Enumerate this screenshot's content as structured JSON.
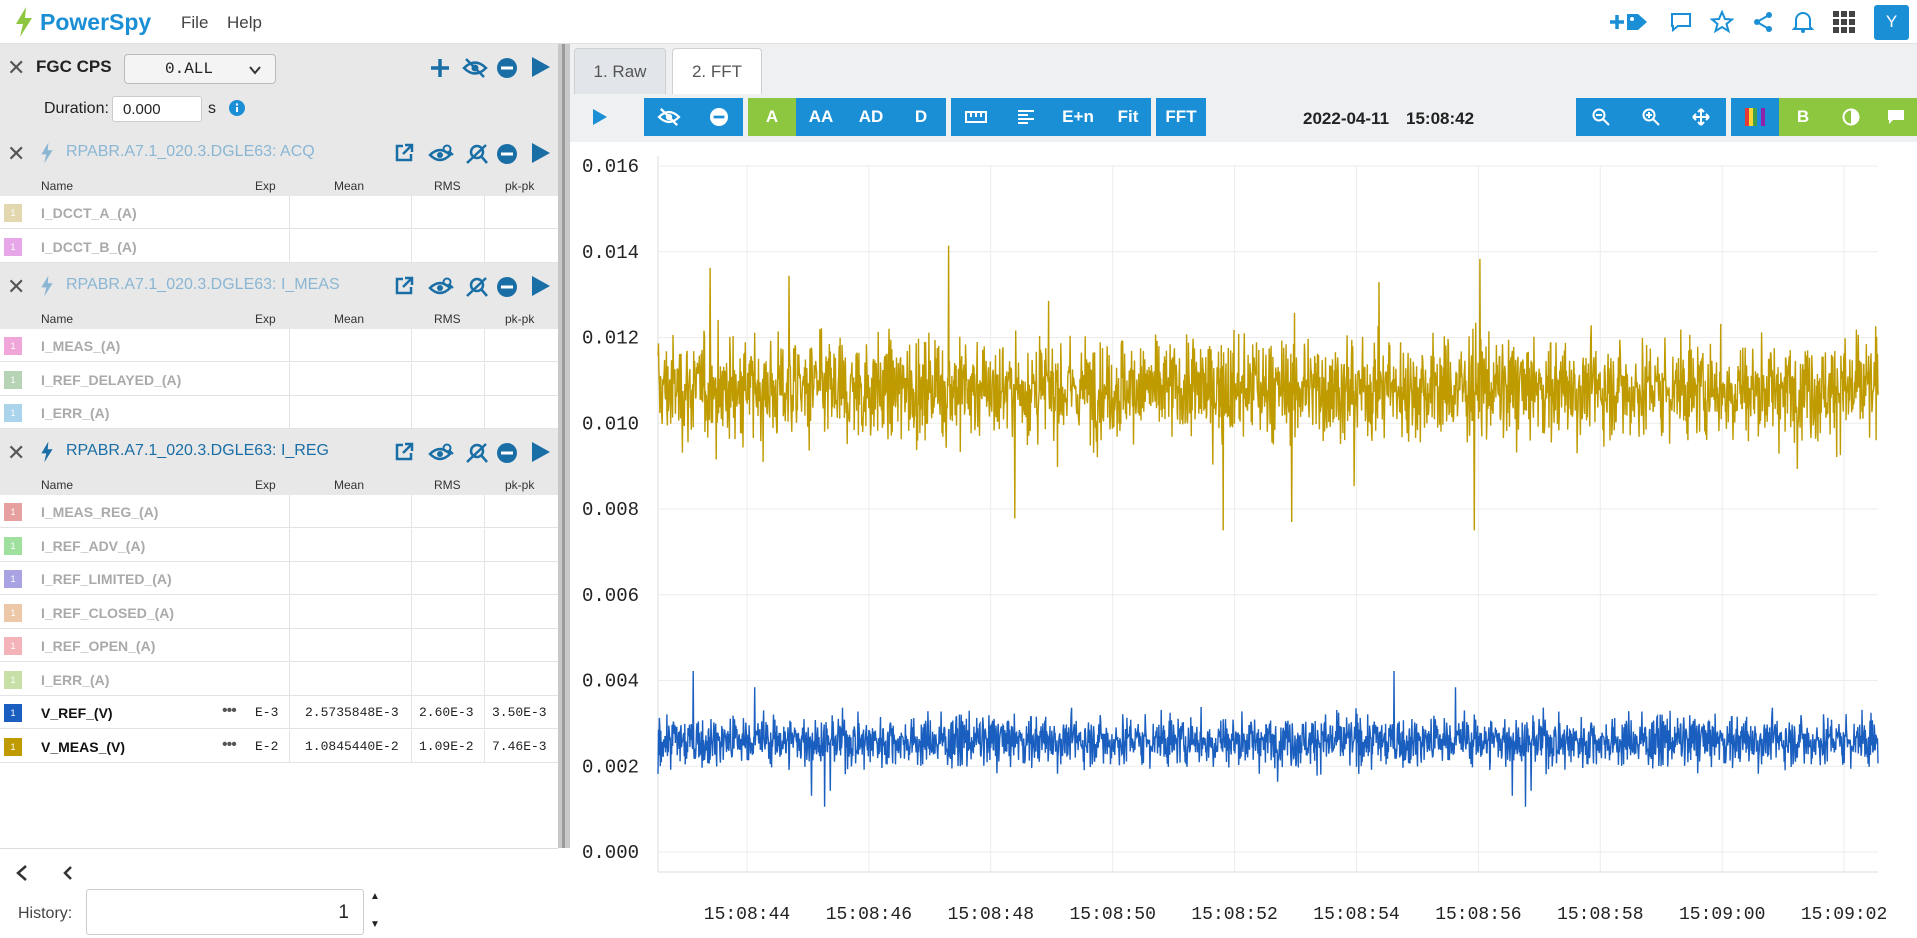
{
  "app": {
    "name": "PowerSpy",
    "menu": [
      "File",
      "Help"
    ],
    "user_initial": "Y",
    "accent": "#1a8fd6",
    "green": "#8dc63f"
  },
  "top_icons": [
    "add-tag-icon",
    "comment-icon",
    "star-icon",
    "share-icon",
    "bell-icon",
    "grid-icon"
  ],
  "device": {
    "name": "FGC CPS",
    "selector": "0.ALL",
    "duration_label": "Duration:",
    "duration_value": "0.000",
    "duration_unit": "s"
  },
  "columns": {
    "name": "Name",
    "exp": "Exp",
    "mean": "Mean",
    "rms": "RMS",
    "pkpk": "pk-pk"
  },
  "groups": [
    {
      "title": "RPABR.A7.1_020.3.DGLE63: ACQ",
      "active": false,
      "signals": [
        {
          "swatch": "#e3d7b0",
          "name": "I_DCCT_A_(A)"
        },
        {
          "swatch": "#e7a6e7",
          "name": "I_DCCT_B_(A)"
        }
      ]
    },
    {
      "title": "RPABR.A7.1_020.3.DGLE63: I_MEAS",
      "active": false,
      "signals": [
        {
          "swatch": "#f0a6d8",
          "name": "I_MEAS_(A)"
        },
        {
          "swatch": "#b7d3b5",
          "name": "I_REF_DELAYED_(A)"
        },
        {
          "swatch": "#a9d4ec",
          "name": "I_ERR_(A)"
        }
      ]
    },
    {
      "title": "RPABR.A7.1_020.3.DGLE63: I_REG",
      "active": true,
      "signals": [
        {
          "swatch": "#e7a0a0",
          "name": "I_MEAS_REG_(A)"
        },
        {
          "swatch": "#9fe09f",
          "name": "I_REF_ADV_(A)"
        },
        {
          "swatch": "#a9a3e3",
          "name": "I_REF_LIMITED_(A)"
        },
        {
          "swatch": "#ecc8a8",
          "name": "I_REF_CLOSED_(A)"
        },
        {
          "swatch": "#f3b3b9",
          "name": "I_REF_OPEN_(A)"
        },
        {
          "swatch": "#c8dfa8",
          "name": "I_ERR_(A)"
        },
        {
          "swatch": "#1a5fbf",
          "name": "V_REF_(V)",
          "active": true,
          "exp": "E-3",
          "mean": "2.5735848E-3",
          "rms": "2.60E-3",
          "pkpk": "3.50E-3"
        },
        {
          "swatch": "#bf9b00",
          "name": "V_MEAS_(V)",
          "active": true,
          "exp": "E-2",
          "mean": "1.0845440E-2",
          "rms": "1.09E-2",
          "pkpk": "7.46E-3"
        }
      ]
    }
  ],
  "swatch_label": "1",
  "history": {
    "label": "History:",
    "value": "1"
  },
  "tabs": [
    "1. Raw",
    "2. FFT"
  ],
  "toolbar": {
    "modes": [
      "A",
      "AA",
      "AD",
      "D"
    ],
    "tools": [
      "E+n",
      "Fit"
    ],
    "fft": "FFT",
    "date": "2022-04-11",
    "time": "15:08:42",
    "b": "B"
  },
  "chart_data": {
    "type": "line",
    "ylim": [
      0.0,
      0.016
    ],
    "yticks": [
      "0.016",
      "0.014",
      "0.012",
      "0.010",
      "0.008",
      "0.006",
      "0.004",
      "0.002",
      "0.000"
    ],
    "xticks": [
      "15:08:44",
      "15:08:46",
      "15:08:48",
      "15:08:50",
      "15:08:52",
      "15:08:54",
      "15:08:56",
      "15:08:58",
      "15:09:00",
      "15:09:02"
    ],
    "xlim": [
      "15:08:42.6",
      "15:09:02.6"
    ],
    "grid": true,
    "series": [
      {
        "signal": "V_MEAS_(V)",
        "color": "#bf9b00",
        "mean": 0.0108,
        "min": 0.0075,
        "max": 0.015
      },
      {
        "signal": "V_REF_(V)",
        "color": "#1a5fbf",
        "mean": 0.0026,
        "min": 0.0008,
        "max": 0.0043
      }
    ]
  }
}
